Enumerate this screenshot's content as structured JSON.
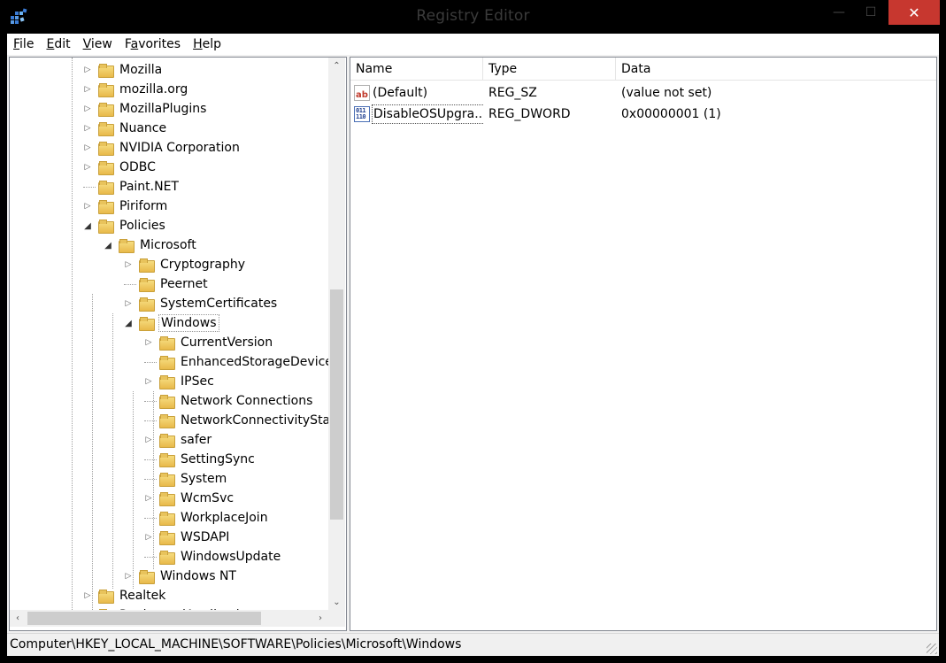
{
  "window": {
    "title": "Registry Editor",
    "minimize_glyph": "—",
    "maximize_glyph": "☐",
    "close_glyph": "✕"
  },
  "menu": [
    "File",
    "Edit",
    "View",
    "Favorites",
    "Help"
  ],
  "tree": {
    "items": [
      {
        "label": "Mozilla",
        "depth": 0,
        "expander": "collapsed"
      },
      {
        "label": "mozilla.org",
        "depth": 0,
        "expander": "collapsed"
      },
      {
        "label": "MozillaPlugins",
        "depth": 0,
        "expander": "collapsed"
      },
      {
        "label": "Nuance",
        "depth": 0,
        "expander": "collapsed"
      },
      {
        "label": "NVIDIA Corporation",
        "depth": 0,
        "expander": "collapsed"
      },
      {
        "label": "ODBC",
        "depth": 0,
        "expander": "collapsed"
      },
      {
        "label": "Paint.NET",
        "depth": 0,
        "expander": "none"
      },
      {
        "label": "Piriform",
        "depth": 0,
        "expander": "collapsed"
      },
      {
        "label": "Policies",
        "depth": 0,
        "expander": "expanded"
      },
      {
        "label": "Microsoft",
        "depth": 1,
        "expander": "expanded"
      },
      {
        "label": "Cryptography",
        "depth": 2,
        "expander": "collapsed"
      },
      {
        "label": "Peernet",
        "depth": 2,
        "expander": "none"
      },
      {
        "label": "SystemCertificates",
        "depth": 2,
        "expander": "collapsed"
      },
      {
        "label": "Windows",
        "depth": 2,
        "expander": "expanded",
        "selected": true
      },
      {
        "label": "CurrentVersion",
        "depth": 3,
        "expander": "collapsed"
      },
      {
        "label": "EnhancedStorageDevices",
        "depth": 3,
        "expander": "none"
      },
      {
        "label": "IPSec",
        "depth": 3,
        "expander": "collapsed"
      },
      {
        "label": "Network Connections",
        "depth": 3,
        "expander": "none"
      },
      {
        "label": "NetworkConnectivityStatusIndicator",
        "depth": 3,
        "expander": "none"
      },
      {
        "label": "safer",
        "depth": 3,
        "expander": "collapsed"
      },
      {
        "label": "SettingSync",
        "depth": 3,
        "expander": "none"
      },
      {
        "label": "System",
        "depth": 3,
        "expander": "none"
      },
      {
        "label": "WcmSvc",
        "depth": 3,
        "expander": "collapsed"
      },
      {
        "label": "WorkplaceJoin",
        "depth": 3,
        "expander": "none"
      },
      {
        "label": "WSDAPI",
        "depth": 3,
        "expander": "collapsed"
      },
      {
        "label": "WindowsUpdate",
        "depth": 3,
        "expander": "none"
      },
      {
        "label": "Windows NT",
        "depth": 2,
        "expander": "collapsed"
      },
      {
        "label": "Realtek",
        "depth": 0,
        "expander": "collapsed"
      },
      {
        "label": "RegisteredApplications",
        "depth": 0,
        "expander": "none"
      }
    ]
  },
  "list": {
    "columns": [
      "Name",
      "Type",
      "Data"
    ],
    "rows": [
      {
        "icon": "string-value-icon",
        "icon_text": "ab",
        "name": "(Default)",
        "type": "REG_SZ",
        "data": "(value not set)"
      },
      {
        "icon": "dword-value-icon",
        "icon_text": "011 110",
        "name": "DisableOSUpgra...",
        "type": "REG_DWORD",
        "data": "0x00000001 (1)",
        "focused": true
      }
    ]
  },
  "status": {
    "path": "Computer\\HKEY_LOCAL_MACHINE\\SOFTWARE\\Policies\\Microsoft\\Windows"
  },
  "colors": {
    "close_button": "#c7372f",
    "folder": "#e8b94a"
  }
}
